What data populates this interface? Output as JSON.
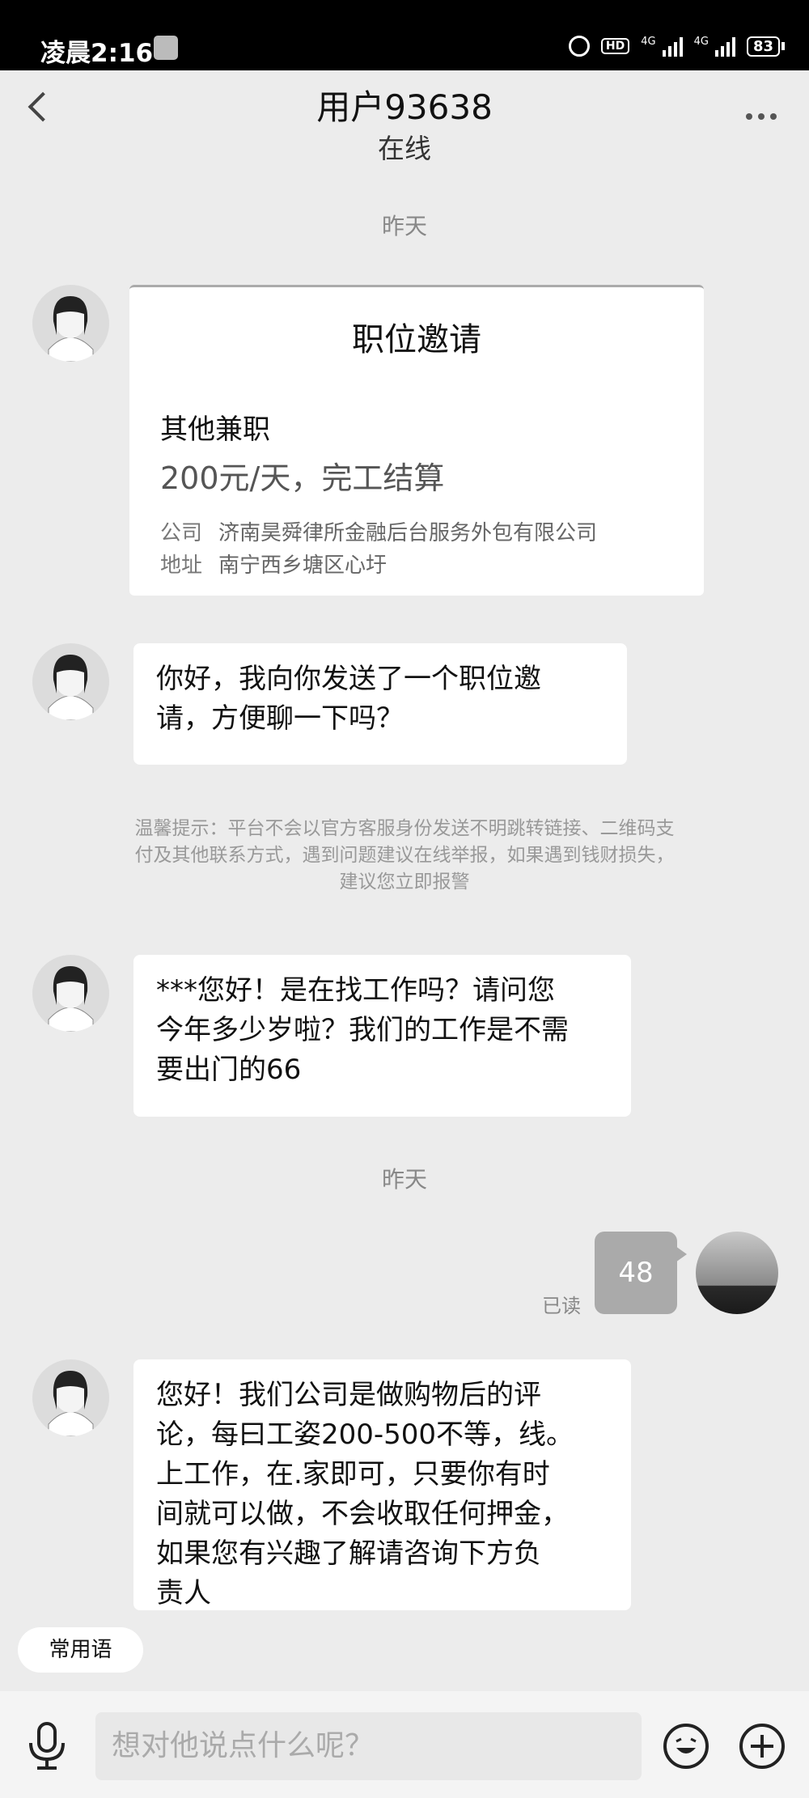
{
  "status_bar": {
    "time": "凌晨2:16",
    "hd": "HD",
    "network_1": "4G",
    "network_2": "4G",
    "battery": "83"
  },
  "header": {
    "title": "用户93638",
    "subtitle": "在线"
  },
  "date_labels": [
    "昨天",
    "昨天"
  ],
  "job_card": {
    "title": "职位邀请",
    "job": "其他兼职",
    "pay": "200元/天，完工结算",
    "company_label": "公司",
    "company_value": "济南昊舜律所金融后台服务外包有限公司",
    "address_label": "地址",
    "address_value": "南宁西乡塘区心圩"
  },
  "messages": {
    "msg1_line1": "你好，我向你发送了一个职位邀",
    "msg1_line2": "请，方便聊一下吗？",
    "notice": "温馨提示：平台不会以官方客服身份发送不明跳转链接、二维码支付及其他联系方式，遇到问题建议在线举报，如果遇到钱财损失，建议您立即报警",
    "msg2_line1": "***您好！是在找工作吗？请问您",
    "msg2_line2": "今年多少岁啦？我们的工作是不需",
    "msg2_line3": "要出门的66",
    "my_msg": "48",
    "read_status": "已读",
    "msg3_line1": "您好！我们公司是做购物后的评",
    "msg3_line2": "论，每曰工姿200-500不等，线。",
    "msg3_line3": "上工作，在.家即可，只要你有时",
    "msg3_line4": "间就可以做，不会收取任何押金，",
    "msg3_line5": "如果您有兴趣了解请咨询下方负",
    "msg3_line6": "责人"
  },
  "quick_phrases": "常用语",
  "input_placeholder": "想对他说点什么呢？",
  "icons": [
    "back-arrow-icon",
    "more-dots-icon",
    "microphone-icon",
    "emoji-icon",
    "plus-icon",
    "alarm-icon",
    "signal-icon",
    "battery-icon"
  ]
}
